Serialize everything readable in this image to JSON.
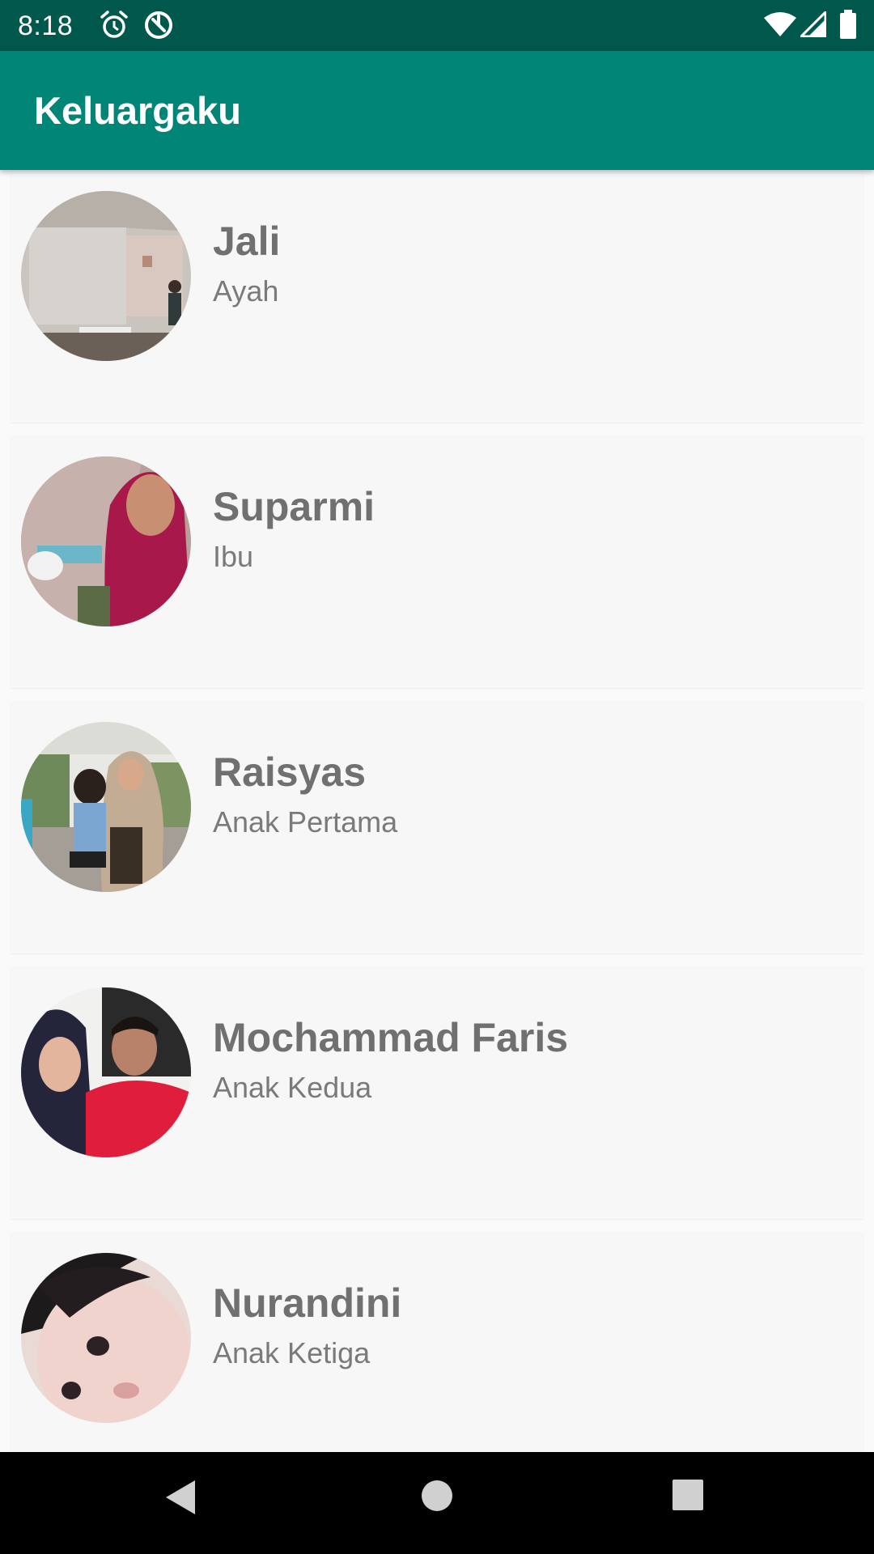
{
  "status_bar": {
    "time": "8:18",
    "icons": [
      "alarm-icon",
      "data-saver-icon",
      "wifi-icon",
      "cell-signal-icon",
      "battery-icon"
    ]
  },
  "app_bar": {
    "title": "Keluargaku"
  },
  "members": [
    {
      "name": "Jali",
      "role": "Ayah",
      "photo": "avatar-jali"
    },
    {
      "name": "Suparmi",
      "role": "Ibu",
      "photo": "avatar-suparmi"
    },
    {
      "name": "Raisyas",
      "role": "Anak Pertama",
      "photo": "avatar-raisyas"
    },
    {
      "name": "Mochammad Faris",
      "role": "Anak Kedua",
      "photo": "avatar-faris"
    },
    {
      "name": "Nurandini",
      "role": "Anak Ketiga",
      "photo": "avatar-nurandini"
    }
  ],
  "nav_bar": {
    "buttons": [
      "back-icon",
      "home-icon",
      "recents-icon"
    ]
  },
  "colors": {
    "status_bar": "#00574b",
    "app_bar": "#008577",
    "card_bg": "#f7f7f7",
    "name_text": "#707070",
    "role_text": "#7a7a7a"
  }
}
